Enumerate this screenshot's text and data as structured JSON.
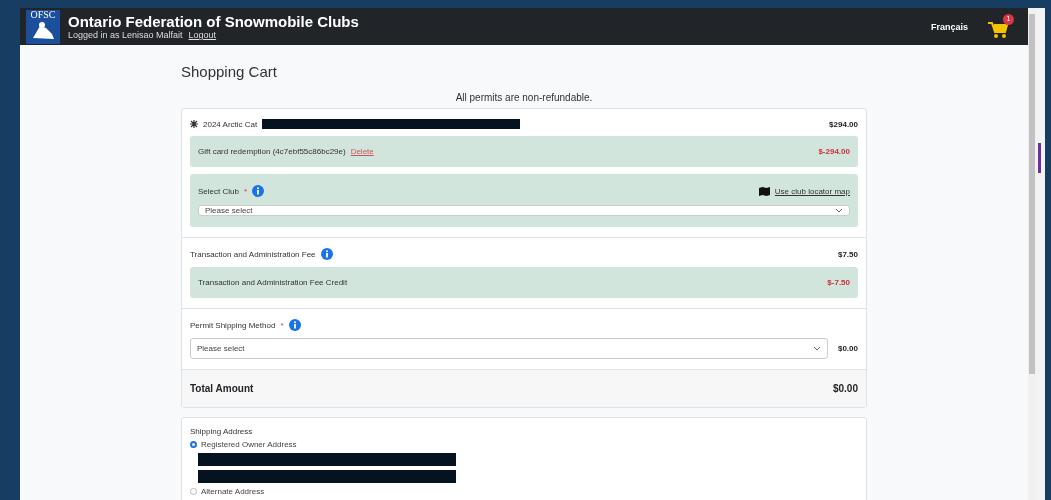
{
  "header": {
    "logo_text": "OFSC",
    "title": "Ontario Federation of Snowmobile Clubs",
    "logged_in": "Logged in as Lenisao Malfait",
    "logout": "Logout",
    "language": "Français",
    "cart_count": "1"
  },
  "page_title": "Shopping Cart",
  "notice": "All permits are non-refundable.",
  "item": {
    "name": "2024 Arctic Cat",
    "price": "$294.00",
    "redacted": true
  },
  "gift_card": {
    "label": "Gift card redemption (4c7ebf55c86bc29e)",
    "action": "Delete",
    "amount": "$-294.00"
  },
  "club": {
    "label": "Select Club",
    "required_mark": "*",
    "map_link": "Use club locator map",
    "placeholder": "Please select"
  },
  "fee": {
    "label": "Transaction and Administration Fee",
    "amount": "$7.50",
    "credit_label": "Transaction and Administration Fee Credit",
    "credit_amount": "$-7.50"
  },
  "shipping_method": {
    "label": "Permit Shipping Method",
    "required_mark": "*",
    "placeholder": "Please select",
    "amount": "$0.00"
  },
  "total": {
    "label": "Total Amount",
    "amount": "$0.00"
  },
  "shipping_address": {
    "title": "Shipping Address",
    "options": [
      {
        "label": "Registered Owner Address",
        "selected": true,
        "redacted": true
      },
      {
        "label": "Alternate Address",
        "selected": false
      }
    ]
  }
}
